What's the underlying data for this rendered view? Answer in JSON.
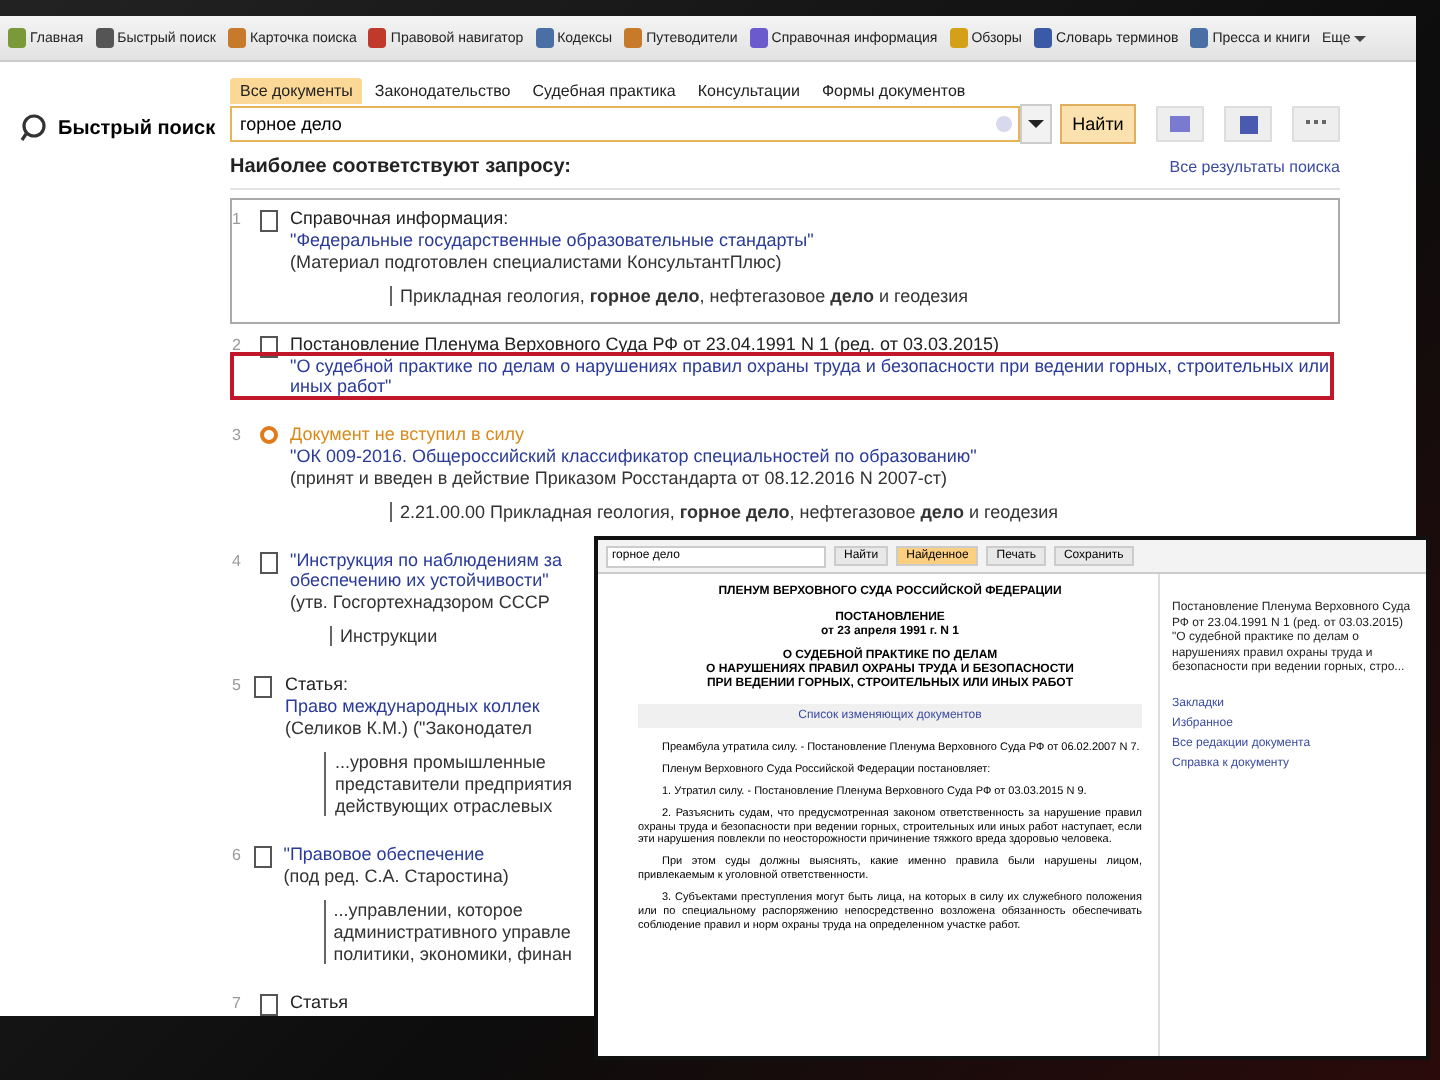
{
  "toolbar": {
    "items": [
      {
        "label": "Главная"
      },
      {
        "label": "Быстрый поиск"
      },
      {
        "label": "Карточка поиска"
      },
      {
        "label": "Правовой навигатор"
      },
      {
        "label": "Кодексы"
      },
      {
        "label": "Путеводители"
      },
      {
        "label": "Справочная информация"
      },
      {
        "label": "Обзоры"
      },
      {
        "label": "Словарь терминов"
      },
      {
        "label": "Пресса и книги"
      }
    ],
    "more": "Еще"
  },
  "search_panel": {
    "title": "Быстрый поиск",
    "tabs": [
      {
        "label": "Все документы",
        "selected": true
      },
      {
        "label": "Законодательство",
        "selected": false
      },
      {
        "label": "Судебная практика",
        "selected": false
      },
      {
        "label": "Консультации",
        "selected": false
      },
      {
        "label": "Формы документов",
        "selected": false
      }
    ],
    "query": "горное дело",
    "button": "Найти",
    "all_results_link": "Все результаты поиска"
  },
  "results": {
    "heading": "Наиболее соответствуют запросу:",
    "items": [
      {
        "number": "1",
        "kind": "document",
        "selected": true,
        "status": "Справочная информация:",
        "title": [
          "\"Федеральные государственные образовательные стандарты\""
        ],
        "note": [
          "(Материал подготовлен специалистами КонсультантПлюс)"
        ],
        "snippet": [
          "Прикладная геология, **горное дело**, нефтегазовое **дело** и геодезия"
        ]
      },
      {
        "number": "2",
        "kind": "document",
        "selected": false,
        "highlighted": true,
        "status": "Постановление Пленума Верховного Суда РФ от 23.04.1991 N 1 (ред. от 03.03.2015)",
        "title": [
          "\"О судебной практике по делам о нарушениях правил охраны труда и безопасности при ведении горных, строительных или",
          "иных работ\""
        ]
      },
      {
        "number": "3",
        "kind": "not_in_force",
        "selected": false,
        "status": "Документ не вступил в силу",
        "title": [
          "\"ОК 009-2016. Общероссийский классификатор специальностей по образованию\""
        ],
        "note": [
          "(принят и введен в действие Приказом Росстандарта от 08.12.2016 N 2007-ст)"
        ],
        "snippet": [
          "2.21.00.00 Прикладная геология, **горное дело**, нефтегазовое **дело** и геодезия"
        ]
      },
      {
        "number": "4",
        "kind": "document",
        "selected": false,
        "title": [
          "\"Инструкция по наблюдениям за",
          "обеспечению их устойчивости\""
        ],
        "note": [
          "(утв. Госгортехнадзором СССР"
        ],
        "snippet": [
          "Инструкции"
        ]
      },
      {
        "number": "5",
        "kind": "document",
        "selected": false,
        "status": "Статья:",
        "title": [
          "Право международных коллек"
        ],
        "note": [
          "(Селиков К.М.) (\"Законодател"
        ],
        "snippet": [
          "...уровня промышленные",
          "представители предприятия",
          "действующих отраслевых"
        ]
      },
      {
        "number": "6",
        "kind": "document",
        "selected": false,
        "title": [
          "\"Правовое обеспечение"
        ],
        "note": [
          "(под ред. С.А. Старостина)"
        ],
        "snippet": [
          "...управлении, которое",
          "административного управле",
          "политики, экономики, финан"
        ]
      },
      {
        "number": "7",
        "kind": "document",
        "selected": false,
        "status": "Статья"
      }
    ]
  },
  "document_window": {
    "search": "горное дело",
    "buttons": [
      "Найти",
      "Найденное",
      "Печать",
      "Сохранить"
    ],
    "header_lines": [
      "ПЛЕНУМ ВЕРХОВНОГО СУДА РОССИЙСКОЙ ФЕДЕРАЦИИ",
      "ПОСТАНОВЛЕНИЕ",
      "от 23 апреля 1991 г. N 1",
      "О СУДЕБНОЙ ПРАКТИКЕ ПО **ДЕЛАМ**",
      "О НАРУШЕНИЯХ ПРАВИЛ ОХРАНЫ ТРУДА И БЕЗОПАСНОСТИ",
      "ПРИ ВЕДЕНИИ ГОРНЫХ, СТРОИТЕЛЬНЫХ ИЛИ ИНЫХ РАБОТ"
    ],
    "changes_link": "Список изменяющих документов",
    "paragraphs": [
      "Преамбула утратила силу. - Постановление Пленума Верховного Суда РФ от 06.02.2007 N 7.",
      "Пленум Верховного Суда Российской Федерации постановляет:",
      "1. Утратил силу. - Постановление Пленума Верховного Суда РФ от 03.03.2015 N 9.",
      "2. Разъяснить судам, что предусмотренная законом ответственность за нарушение правил охраны труда и безопасности при ведении горных, строительных или иных работ наступает, если эти нарушения повлекли по неосторожности причинение тяжкого вреда здоровью человека.",
      "При этом суды должны выяснять, какие именно правила были нарушены лицом, привлекаемым к уголовной ответственности.",
      "3. Субъектами преступления могут быть лица, на которых в силу их служебного положения или по специальному распоряжению непосредственно возложена обязанность обеспечивать соблюдение правил и норм охраны труда на определенном участке работ."
    ],
    "side_panel": {
      "description": "Постановление Пленума Верховного Суда РФ от 23.04.1991 N 1 (ред. от 03.03.2015) \"О судебной практике по делам о нарушениях правил охраны труда и безопасности при ведении горных, стро...",
      "links": [
        "Закладки",
        "Избранное",
        "Все редакции документа",
        "Справка к документу"
      ]
    }
  }
}
